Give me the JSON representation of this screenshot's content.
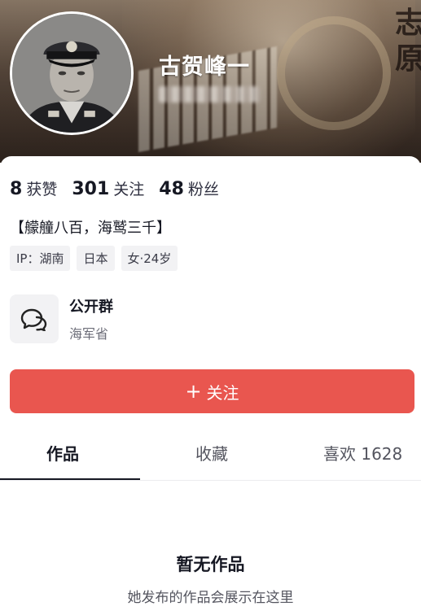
{
  "profile": {
    "nickname": "古贺峰一",
    "banner_text": "志原"
  },
  "stats": [
    {
      "count": "8",
      "label": "获赞"
    },
    {
      "count": "301",
      "label": "关注"
    },
    {
      "count": "48",
      "label": "粉丝"
    }
  ],
  "bio": "【艨艟八百，海鹫三千】",
  "tags": [
    "IP：湖南",
    "日本",
    "女·24岁"
  ],
  "group": {
    "title": "公开群",
    "subtitle": "海军省"
  },
  "follow_button": {
    "plus": "+",
    "label": "关注"
  },
  "tabs": {
    "works": "作品",
    "favorites": "收藏",
    "likes": "喜欢 1628"
  },
  "empty_state": {
    "title": "暂无作品",
    "subtitle": "她发布的作品会展示在这里"
  },
  "colors": {
    "accent": "#e9564f",
    "text_primary": "#161823",
    "tag_bg": "#f2f2f4"
  }
}
